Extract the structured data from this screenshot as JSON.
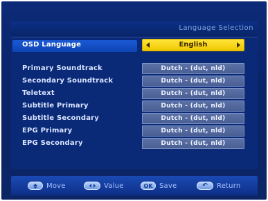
{
  "header": {
    "title": "Language Selection"
  },
  "osd": {
    "label": "OSD Language",
    "value": "English"
  },
  "settings": [
    {
      "label": "Primary Soundtrack",
      "value": "Dutch - (dut, nld)"
    },
    {
      "label": "Secondary Soundtrack",
      "value": "Dutch - (dut, nld)"
    },
    {
      "label": "Teletext",
      "value": "Dutch - (dut, nld)"
    },
    {
      "label": "Subtitle Primary",
      "value": "Dutch - (dut, nld)"
    },
    {
      "label": "Subtitle Secondary",
      "value": "Dutch - (dut, nld)"
    },
    {
      "label": "EPG Primary",
      "value": "Dutch - (dut, nld)"
    },
    {
      "label": "EPG Secondary",
      "value": "Dutch - (dut, nld)"
    }
  ],
  "footer": {
    "move": {
      "label": "Move",
      "icon": "up-down-arrows-icon"
    },
    "value": {
      "label": "Value",
      "icon": "left-right-arrows-icon"
    },
    "save": {
      "label": "Save",
      "key": "OK"
    },
    "return": {
      "label": "Return",
      "icon": "return-icon"
    }
  },
  "colors": {
    "background": "#0a2468",
    "highlight": "#1a5ad6",
    "selected_value": "#ffe53a",
    "value_box": "#5b72a7"
  }
}
